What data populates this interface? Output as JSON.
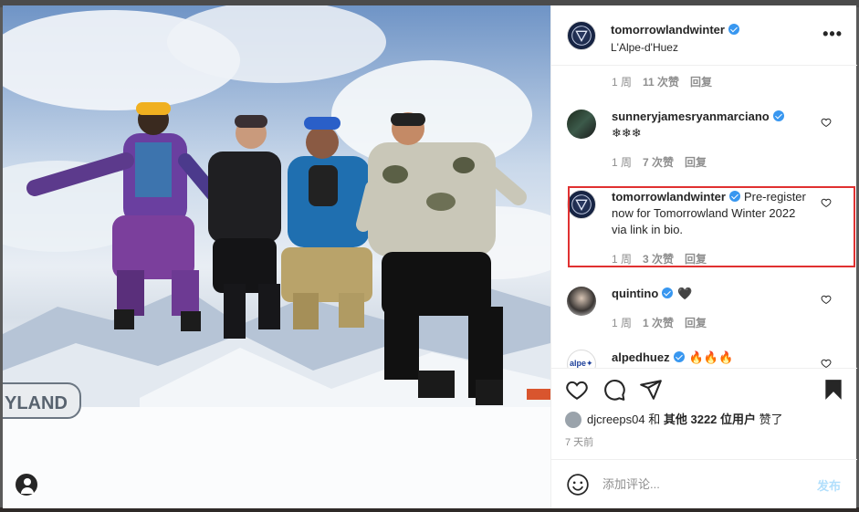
{
  "post": {
    "author": "tomorrowlandwinter",
    "location": "L'Alpe-d'Huez"
  },
  "banner_text": "YLAND",
  "comments": [
    {
      "time": "1 周",
      "likes": "11 次赞",
      "reply": "回复"
    },
    {
      "user": "sunneryjamesryanmarciano",
      "text": "❄❄❄",
      "time": "1 周",
      "likes": "7 次赞",
      "reply": "回复"
    },
    {
      "user": "tomorrowlandwinter",
      "text": "Pre-register now for Tomorrowland Winter 2022 via link in bio.",
      "time": "1 周",
      "likes": "3 次赞",
      "reply": "回复"
    },
    {
      "user": "quintino",
      "text": "🖤",
      "time": "1 周",
      "likes": "1 次赞",
      "reply": "回复"
    },
    {
      "user": "alpedhuez",
      "text": "🔥🔥🔥"
    }
  ],
  "alpe_logo_text": "alpe✦",
  "likes": {
    "user": "djcreeps04",
    "and": "和",
    "others": "其他 3222 位用户",
    "suffix": "赞了"
  },
  "time_ago": "7 天前",
  "comment_box": {
    "placeholder": "添加评论...",
    "post_label": "发布"
  },
  "colors": {
    "verified": "#3897f0",
    "highlight_border": "#e03131",
    "post_button_disabled": "#b2dffc"
  },
  "icons": [
    "heart-icon",
    "comment-icon",
    "share-icon",
    "bookmark-icon",
    "emoji-icon",
    "more-icon",
    "user-tag-icon"
  ]
}
